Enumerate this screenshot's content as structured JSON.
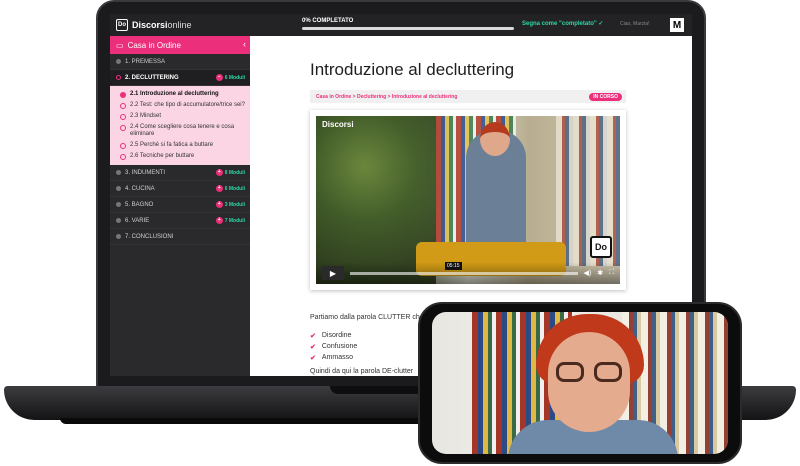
{
  "app": {
    "brand_icon": "Do",
    "brand_bold": "Discorsi",
    "brand_light": "online"
  },
  "topbar": {
    "progress_label": "0% COMPLETATO",
    "progress_value": 0.0,
    "mark_complete": "Segna come \"completato\" ✓",
    "user_name": "Ciao, Marzia!",
    "user_initial": "M"
  },
  "sidebar": {
    "course_title": "Casa in Ordine",
    "collapse_icon": "‹",
    "chapters": [
      {
        "label": "1. PREMESSA",
        "badge": ""
      },
      {
        "label": "2. DECLUTTERING",
        "badge": "6 Moduli"
      },
      {
        "label": "3. INDUMENTI",
        "badge": "8 Moduli"
      },
      {
        "label": "4. CUCINA",
        "badge": "6 Moduli"
      },
      {
        "label": "5. BAGNO",
        "badge": "3 Moduli"
      },
      {
        "label": "6. VARIE",
        "badge": "7 Moduli"
      },
      {
        "label": "7. CONCLUSIONI",
        "badge": ""
      }
    ],
    "lessons": [
      "2.1 Introduzione al decluttering",
      "2.2 Test: che tipo di accumulatore/trice sei?",
      "2.3 Mindset",
      "2.4 Come scegliere cosa tenere e cosa eliminare",
      "2.5 Perché si fa fatica a buttare",
      "2.6 Tecniche per buttare"
    ]
  },
  "main": {
    "title": "Introduzione al decluttering",
    "breadcrumb": "Casa in Ordine > Decluttering > Introduzione al decluttering",
    "status": "IN CORSO",
    "video": {
      "watermark": "Discorsi",
      "time": "05:15",
      "badge": "Do"
    },
    "paragraph": "Partiamo dalla parola CLUTTER che in tradotto in italiano ha diversi significati:",
    "bullets": [
      "Disordine",
      "Confusione",
      "Ammasso"
    ],
    "closing": "Quindi da qui la parola DE-clutter"
  },
  "colors": {
    "accent": "#ec2f7b",
    "green": "#2ed6a5",
    "dark": "#232325"
  }
}
